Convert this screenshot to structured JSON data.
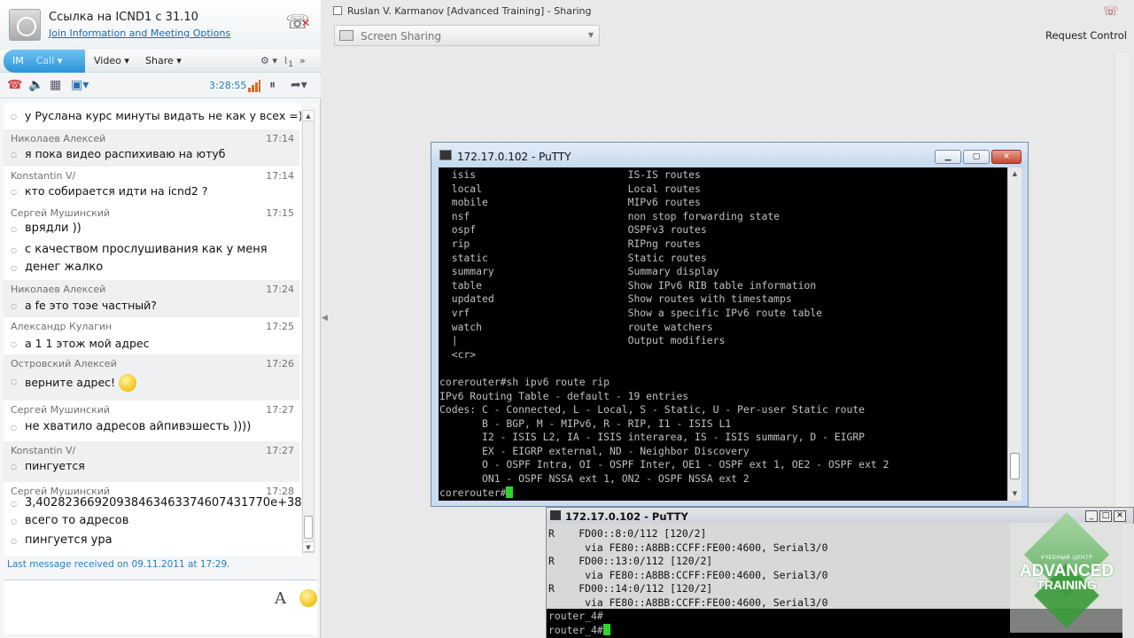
{
  "meeting": {
    "title": "Ссылка на ICND1 с 31.10",
    "join_link": "Join Information and Meeting Options",
    "tabs": {
      "im": "IM",
      "call": "Call",
      "video": "Video",
      "share": "Share"
    },
    "attachments_count": "1",
    "call_timer": "3:28:55"
  },
  "messages": [
    {
      "sender": "",
      "time": "",
      "lines": [
        "у Руслана курс минуты видать не как у всех =)"
      ]
    },
    {
      "sender": "Николаев Алексей",
      "time": "17:14",
      "lines": [
        "я пока видео распихиваю на ютуб"
      ]
    },
    {
      "sender": "Konstantin V/",
      "time": "17:14",
      "lines": [
        "кто собирается идти на icnd2 ?"
      ]
    },
    {
      "sender": "Сергей Мушинский",
      "time": "17:15",
      "lines": [
        "врядли ))",
        "с качеством прослушивания как у меня",
        "денег жалко"
      ]
    },
    {
      "sender": "Николаев Алексей",
      "time": "17:24",
      "lines": [
        "а fe это тоэе частный?"
      ]
    },
    {
      "sender": "Александр Кулагин",
      "time": "17:25",
      "lines": [
        "а 1 1  этож мой адрес"
      ]
    },
    {
      "sender": "Островский Алексей",
      "time": "17:26",
      "lines": [
        "верните адрес!"
      ]
    },
    {
      "sender": "Сергей Мушинский",
      "time": "17:27",
      "lines": [
        " не хватило адресов айпивэшесть ))))"
      ]
    },
    {
      "sender": "Konstantin V/",
      "time": "17:27",
      "lines": [
        "пингуется"
      ]
    },
    {
      "sender": "Сергей Мушинский",
      "time": "17:28",
      "lines": [
        "3,40282366920938463463374607431770e+38",
        "всего то адресов",
        "пингуется ура"
      ]
    }
  ],
  "last_message": "Last message received on 09.11.2011 at 17:29.",
  "font_button": "A",
  "sharing": {
    "presenter": "Ruslan V. Karmanov [Advanced Training]  - Sharing",
    "mode": "Screen Sharing",
    "request_control": "Request Control"
  },
  "putty_main": {
    "title": "172.17.0.102 - PuTTY",
    "lines": [
      "  isis                         IS-IS routes",
      "  local                        Local routes",
      "  mobile                       MIPv6 routes",
      "  nsf                          non stop forwarding state",
      "  ospf                         OSPFv3 routes",
      "  rip                          RIPng routes",
      "  static                       Static routes",
      "  summary                      Summary display",
      "  table                        Show IPv6 RIB table information",
      "  updated                      Show routes with timestamps",
      "  vrf                          Show a specific IPv6 route table",
      "  watch                        route watchers",
      "  |                            Output modifiers",
      "  <cr>",
      "",
      "corerouter#sh ipv6 route rip",
      "IPv6 Routing Table - default - 19 entries",
      "Codes: C - Connected, L - Local, S - Static, U - Per-user Static route",
      "       B - BGP, M - MIPv6, R - RIP, I1 - ISIS L1",
      "       I2 - ISIS L2, IA - ISIS interarea, IS - ISIS summary, D - EIGRP",
      "       EX - EIGRP external, ND - Neighbor Discovery",
      "       O - OSPF Intra, OI - OSPF Inter, OE1 - OSPF ext 1, OE2 - OSPF ext 2",
      "       ON1 - OSPF NSSA ext 1, ON2 - OSPF NSSA ext 2"
    ],
    "prompt": "corerouter#"
  },
  "putty_second": {
    "title": "172.17.0.102 - PuTTY",
    "lines": [
      "R    FD00::8:0/112 [120/2]",
      "      via FE80::A8BB:CCFF:FE00:4600, Serial3/0",
      "R    FD00::13:0/112 [120/2]",
      "      via FE80::A8BB:CCFF:FE00:4600, Serial3/0",
      "R    FD00::14:0/112 [120/2]",
      "      via FE80::A8BB:CCFF:FE00:4600, Serial3/0"
    ],
    "prompt_line": "router_4#",
    "prompt": "router_4#"
  },
  "watermark": {
    "line1": "УЧЕБНЫЙ ЦЕНТР",
    "line2": "ADVANCED",
    "line3": "TRAINING"
  },
  "colors": {
    "accent": "#2a93d8",
    "cursor": "#2fd42f",
    "link": "#1a6bb5"
  }
}
